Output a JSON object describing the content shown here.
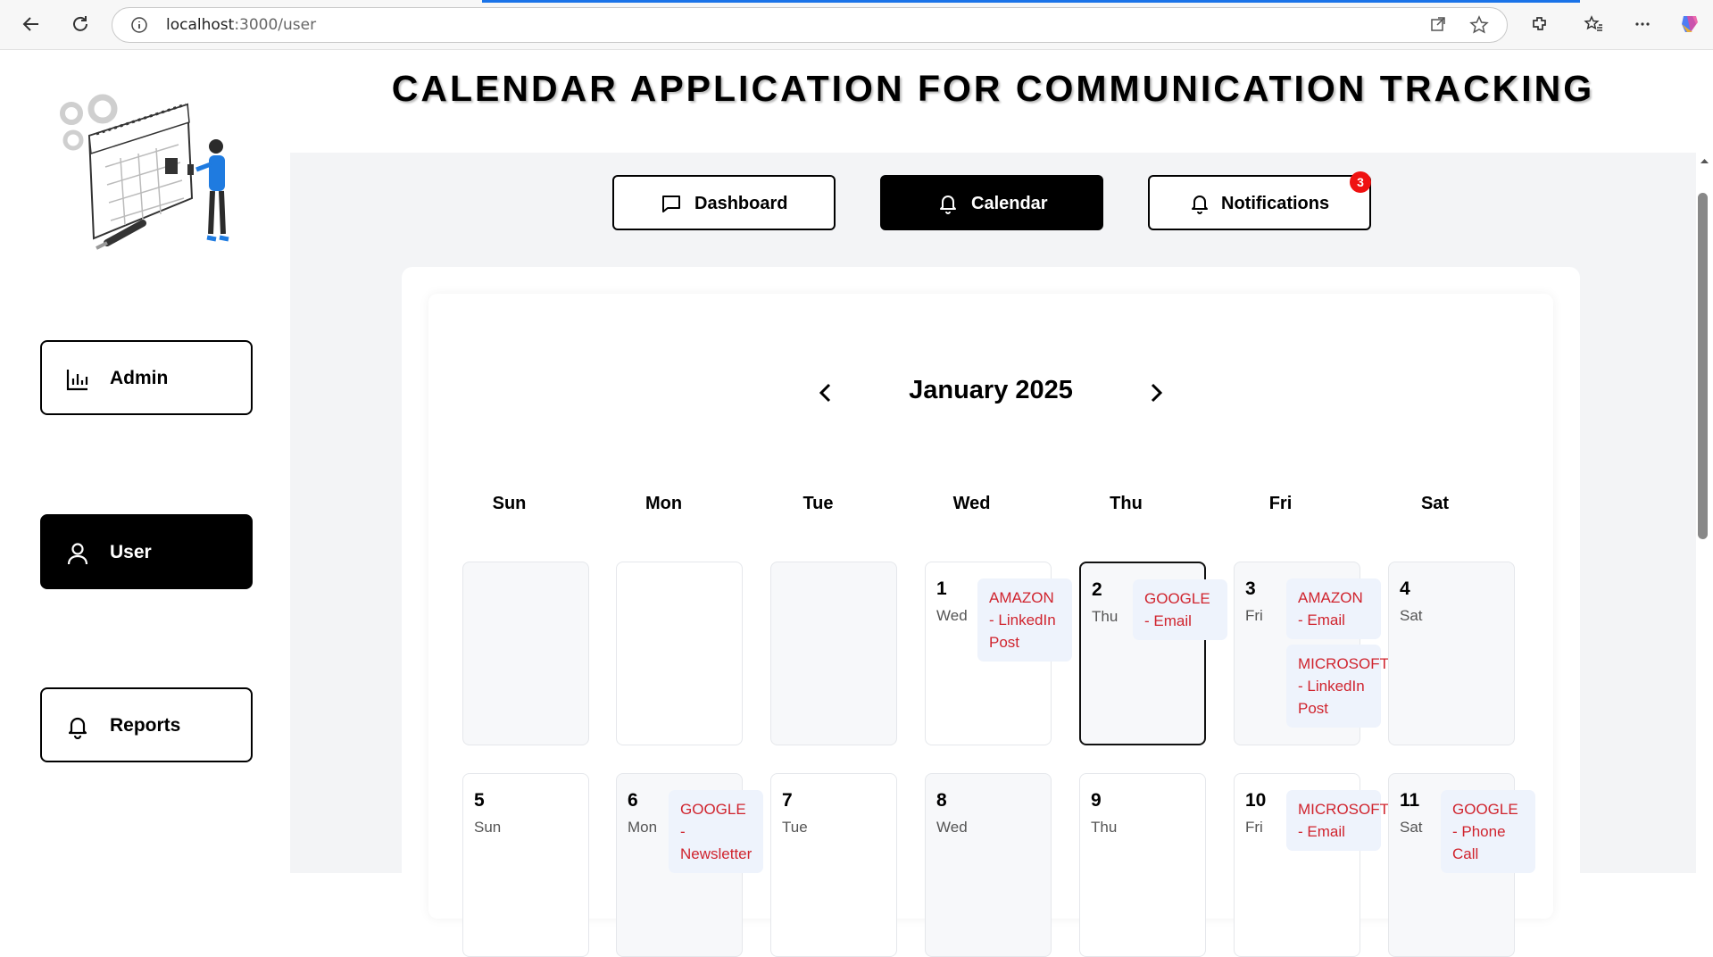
{
  "browser": {
    "url_host": "localhost",
    "url_path": ":3000/user"
  },
  "app": {
    "title": "CALENDAR APPLICATION FOR COMMUNICATION TRACKING"
  },
  "sidebar": {
    "items": [
      {
        "label": "Admin",
        "icon": "bar-chart-icon",
        "active": false
      },
      {
        "label": "User",
        "icon": "user-icon",
        "active": true
      },
      {
        "label": "Reports",
        "icon": "bell-icon",
        "active": false
      }
    ]
  },
  "topnav": {
    "dashboard": "Dashboard",
    "calendar": "Calendar",
    "notifications": "Notifications",
    "notification_count": "3"
  },
  "calendar": {
    "month_label": "January 2025",
    "weekdays": [
      "Sun",
      "Mon",
      "Tue",
      "Wed",
      "Thu",
      "Fri",
      "Sat"
    ],
    "days": [
      {
        "num": "1",
        "dow": "Wed",
        "events": [
          "AMAZON - LinkedIn Post"
        ]
      },
      {
        "num": "2",
        "dow": "Thu",
        "events": [
          "GOOGLE - Email"
        ],
        "today": true
      },
      {
        "num": "3",
        "dow": "Fri",
        "events": [
          "AMAZON - Email",
          "MICROSOFT - LinkedIn Post"
        ]
      },
      {
        "num": "4",
        "dow": "Sat",
        "events": []
      },
      {
        "num": "5",
        "dow": "Sun",
        "events": []
      },
      {
        "num": "6",
        "dow": "Mon",
        "events": [
          "GOOGLE - Newsletter"
        ]
      },
      {
        "num": "7",
        "dow": "Tue",
        "events": []
      },
      {
        "num": "8",
        "dow": "Wed",
        "events": []
      },
      {
        "num": "9",
        "dow": "Thu",
        "events": []
      },
      {
        "num": "10",
        "dow": "Fri",
        "events": [
          "MICROSOFT - Email"
        ]
      },
      {
        "num": "11",
        "dow": "Sat",
        "events": [
          "GOOGLE - Phone Call"
        ]
      }
    ]
  },
  "colors": {
    "accent": "#000000",
    "event_text": "#d0242e",
    "event_bg": "#eef3fc",
    "badge": "#ef1111",
    "main_bg": "#f3f4f6"
  }
}
